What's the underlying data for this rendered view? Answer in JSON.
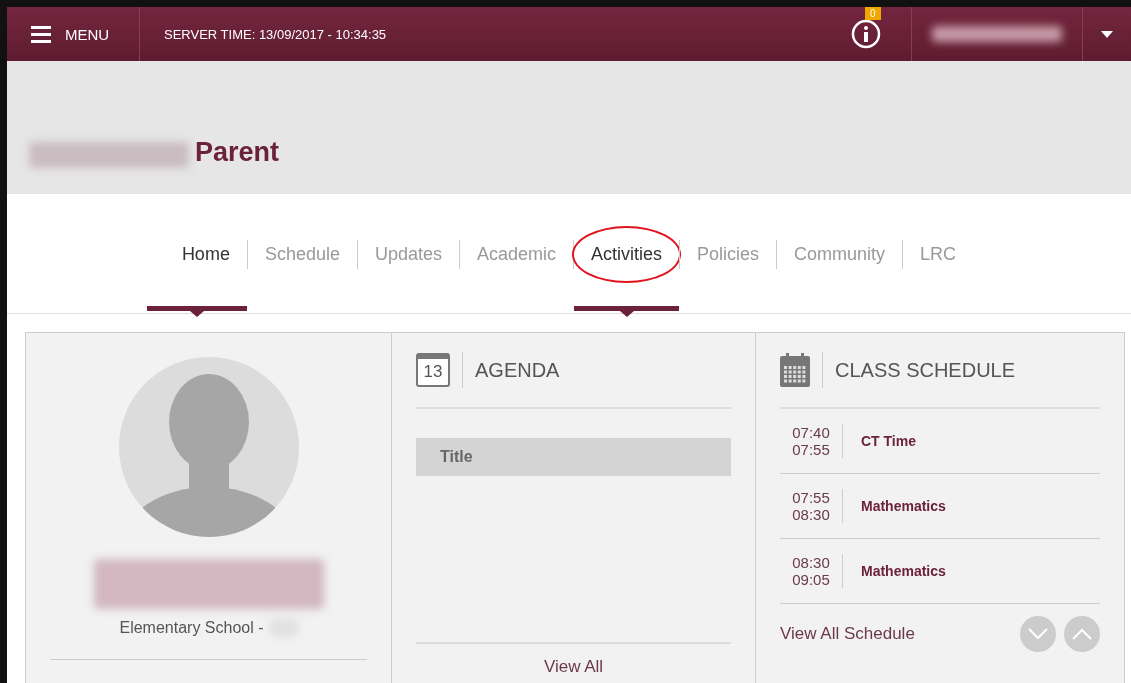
{
  "topbar": {
    "menu_label": "MENU",
    "server_time": "SERVER TIME: 13/09/2017 - 10:34:35",
    "notification_count": "0"
  },
  "header": {
    "role": "Parent"
  },
  "tabs": [
    {
      "label": "Home",
      "selected": true,
      "circled": false
    },
    {
      "label": "Schedule",
      "selected": false,
      "circled": false
    },
    {
      "label": "Updates",
      "selected": false,
      "circled": false
    },
    {
      "label": "Academic",
      "selected": false,
      "circled": false
    },
    {
      "label": "Activities",
      "selected": true,
      "circled": true
    },
    {
      "label": "Policies",
      "selected": false,
      "circled": false
    },
    {
      "label": "Community",
      "selected": false,
      "circled": false
    },
    {
      "label": "LRC",
      "selected": false,
      "circled": false
    }
  ],
  "profile": {
    "school": "Elementary School -"
  },
  "agenda": {
    "title": "AGENDA",
    "calendar_day": "13",
    "column": "Title",
    "view_all": "View All"
  },
  "class_schedule": {
    "title": "CLASS SCHEDULE",
    "rows": [
      {
        "start": "07:40",
        "end": "07:55",
        "subject": "CT Time"
      },
      {
        "start": "07:55",
        "end": "08:30",
        "subject": "Mathematics"
      },
      {
        "start": "08:30",
        "end": "09:05",
        "subject": "Mathematics"
      }
    ],
    "view_all": "View All Schedule"
  }
}
